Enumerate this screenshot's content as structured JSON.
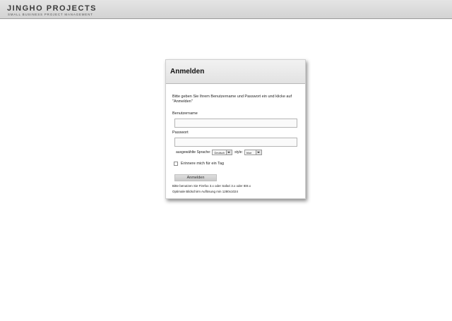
{
  "header": {
    "brand_title": "JINGHO PROJECTS",
    "brand_subtitle": "SMALL BUSINESS PROJECT MANAGEMENT"
  },
  "login": {
    "title": "Anmelden",
    "instructions": "Bitte geben Sie Ihrem Benutzername und Passwort ein und klicke auf \"Anmelden\"",
    "username_label": "Benutzername",
    "username_value": "",
    "password_label": "Passwort",
    "password_value": "",
    "language_label": "ausgewählte Sprache:",
    "language_value": "Deutsch",
    "style_label": "style:",
    "style_value": "blue",
    "remember_label": "Erinnere mich für ein Tag",
    "remember_checked": false,
    "submit_label": "Anmelden",
    "note_browsers": "Bitte benutzen Sie Firefox 3.x oder Safari 3.x oder IE8.x",
    "note_resolution": "Optimale Bildschirm Auflösung min 1280x1024"
  }
}
